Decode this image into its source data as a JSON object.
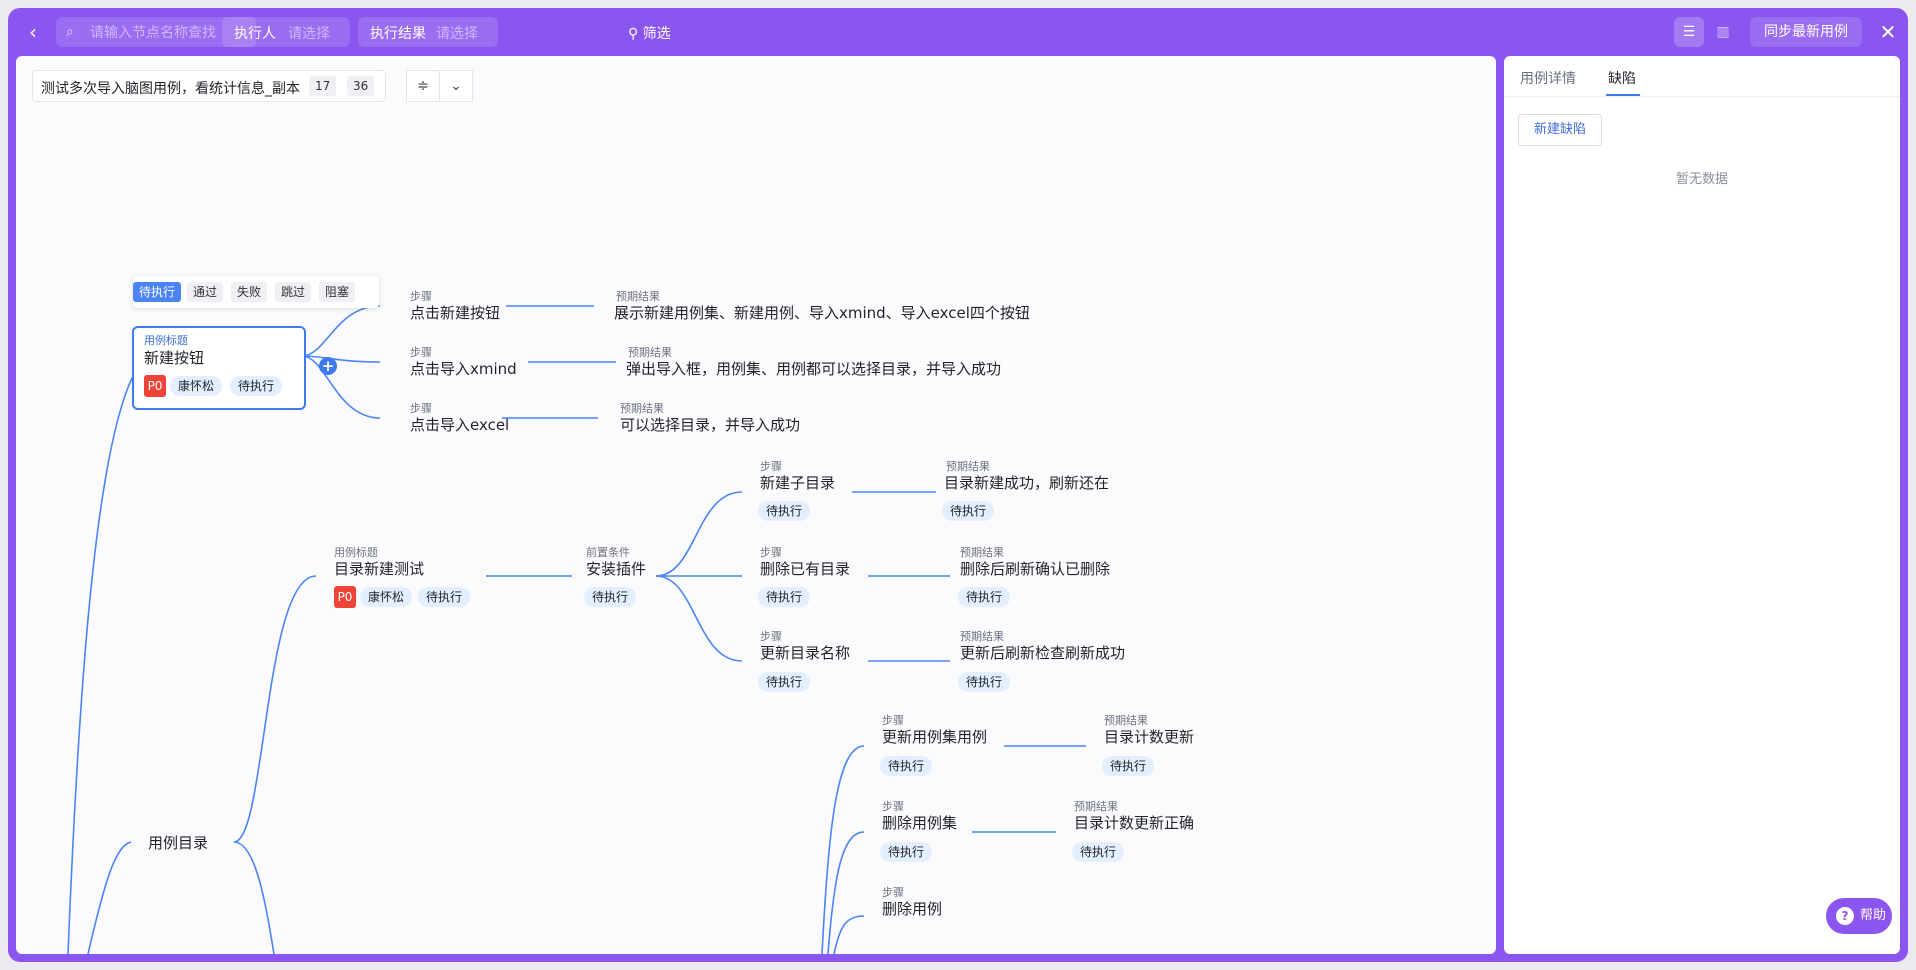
{
  "topbar": {
    "search_placeholder": "请输入节点名称查找",
    "executor_label": "执行人",
    "executor_placeholder": "请选择",
    "result_label": "执行结果",
    "result_placeholder": "请选择",
    "filter_label": "筛选",
    "sync_label": "同步最新用例"
  },
  "suite": {
    "title": "测试多次导入脑图用例，看统计信息_副本",
    "count_a": "17",
    "count_b": "36"
  },
  "status_toolbar": [
    "待执行",
    "通过",
    "失败",
    "跳过",
    "阻塞"
  ],
  "labels": {
    "case_title": "用例标题",
    "step": "步骤",
    "expected": "预期结果",
    "precondition": "前置条件"
  },
  "tree": {
    "case1": {
      "title": "新建按钮",
      "priority": "P0",
      "owner": "康怀松",
      "status": "待执行"
    },
    "case1_steps": [
      {
        "step": "点击新建按钮",
        "expected": "展示新建用例集、新建用例、导入xmind、导入excel四个按钮"
      },
      {
        "step": "点击导入xmind",
        "expected": "弹出导入框，用例集、用例都可以选择目录，并导入成功"
      },
      {
        "step": "点击导入excel",
        "expected": "可以选择目录，并导入成功"
      }
    ],
    "case2": {
      "title": "目录新建测试",
      "priority": "P0",
      "owner": "康怀松",
      "status": "待执行"
    },
    "case2_pre": {
      "text": "安装插件",
      "status": "待执行"
    },
    "case2_steps": [
      {
        "step": "新建子目录",
        "expected": "目录新建成功，刷新还在",
        "status": "待执行"
      },
      {
        "step": "删除已有目录",
        "expected": "删除后刷新确认已删除",
        "status": "待执行"
      },
      {
        "step": "更新目录名称",
        "expected": "更新后刷新检查刷新成功",
        "status": "待执行"
      }
    ],
    "group": "用例目录",
    "case3_steps": [
      {
        "step": "更新用例集用例",
        "expected": "目录计数更新",
        "status": "待执行"
      },
      {
        "step": "删除用例集",
        "expected": "目录计数更新正确",
        "status": "待执行"
      },
      {
        "step": "删除用例"
      }
    ]
  },
  "panel": {
    "tabs": [
      "用例详情",
      "缺陷"
    ],
    "active_tab": "缺陷",
    "new_bug_label": "新建缺陷",
    "empty_text": "暂无数据"
  },
  "help_label": "帮助",
  "colors": {
    "frame": "#8b55f0",
    "accent": "#3f7bf0",
    "tag": "#e3efff",
    "priority": "#f04438"
  }
}
